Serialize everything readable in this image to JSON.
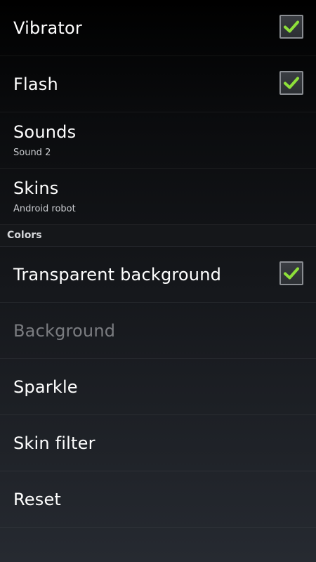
{
  "settings": {
    "items": [
      {
        "title": "Vibrator",
        "checked": true
      },
      {
        "title": "Flash",
        "checked": true
      },
      {
        "title": "Sounds",
        "subtitle": "Sound 2"
      },
      {
        "title": "Skins",
        "subtitle": "Android robot"
      }
    ],
    "colors_section": {
      "header": "Colors",
      "items": [
        {
          "title": "Transparent background",
          "checked": true
        },
        {
          "title": "Background",
          "enabled": false
        },
        {
          "title": "Sparkle"
        },
        {
          "title": "Skin filter"
        },
        {
          "title": "Reset"
        }
      ]
    }
  },
  "theme": {
    "check_color": "#8ee03a",
    "checkbox_border": "#8a8d92",
    "disabled_text": "#7a7c80"
  }
}
